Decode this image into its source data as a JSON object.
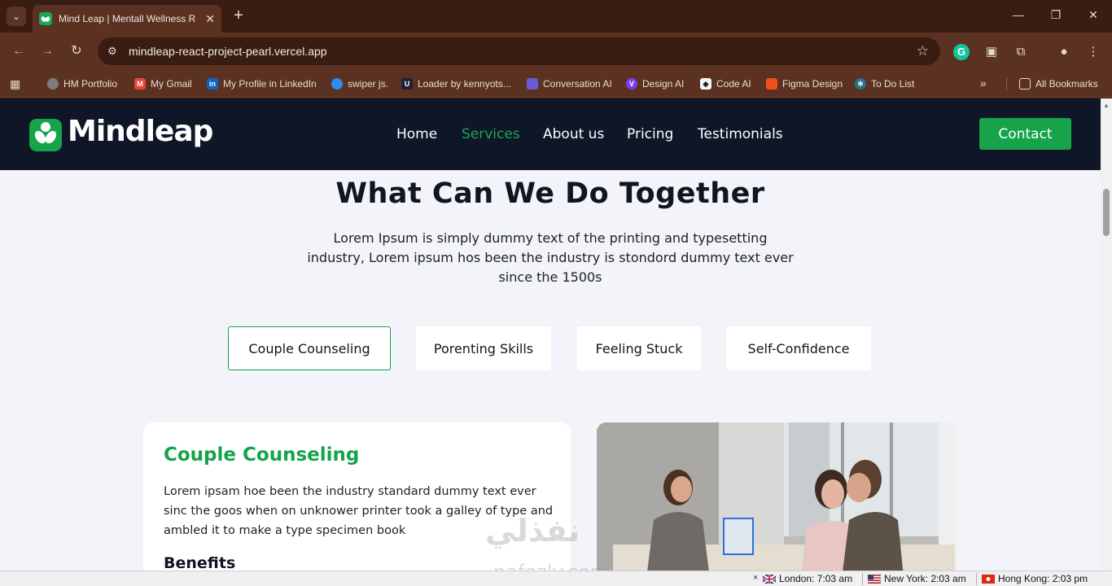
{
  "browser": {
    "tab_title": "Mind Leap | Mentall Wellness R",
    "url": "mindleap-react-project-pearl.vercel.app",
    "new_tab_icon": "plus-icon",
    "bookmarks": [
      {
        "label": "HM Portfolio",
        "icon": "globe-icon",
        "color": "#8a8a8a"
      },
      {
        "label": "My Gmail",
        "icon": "gmail-icon",
        "color": "#ea4335"
      },
      {
        "label": "My Profile in LinkedIn",
        "icon": "linkedin-icon",
        "color": "#0a66c2"
      },
      {
        "label": "swiper js.",
        "icon": "swiper-icon",
        "color": "#2b8cf2"
      },
      {
        "label": "Loader by kennyots...",
        "icon": "uiverse-icon",
        "color": "#1f1f3a"
      },
      {
        "label": "Conversation AI",
        "icon": "ai-icon",
        "color": "#6b5bd6"
      },
      {
        "label": "Design AI",
        "icon": "v0-icon",
        "color": "#7a3cf0"
      },
      {
        "label": "Code AI",
        "icon": "code-icon",
        "color": "#222222"
      },
      {
        "label": "Figma Design",
        "icon": "figma-icon",
        "color": "#f24e1e"
      },
      {
        "label": "To Do List",
        "icon": "react-icon",
        "color": "#2a6f8a"
      }
    ],
    "all_bookmarks": "All Bookmarks"
  },
  "site": {
    "logo": "Mindleap",
    "nav": [
      "Home",
      "Services",
      "About us",
      "Pricing",
      "Testimonials"
    ],
    "active_nav": "Services",
    "contact": "Contact",
    "brand_color": "#16a34a",
    "nav_bg": "#0e1628"
  },
  "section": {
    "title": "What Can We Do Together",
    "description": "Lorem Ipsum is simply dummy text of the printing and typesetting industry, Lorem ipsum hos been the industry is stondord dummy text ever since the 1500s",
    "tabs": [
      "Couple Counseling",
      "Porenting Skills",
      "Feeling Stuck",
      "Self-Confidence"
    ],
    "active_tab": "Couple Counseling"
  },
  "card": {
    "title": "Couple Counseling",
    "text": "Lorem ipsam hoe been the industry standard dummy text ever sinc the goos when on unknower printer took a galley of type and ambled it to make a type specimen book",
    "subtitle": "Benefits"
  },
  "status": {
    "clocks": [
      {
        "city": "London: 7:03 am",
        "flag": "uk-flag-icon"
      },
      {
        "city": "New York: 2:03 am",
        "flag": "us-flag-icon"
      },
      {
        "city": "Hong Kong: 2:03 pm",
        "flag": "hk-flag-icon"
      }
    ]
  },
  "watermark": {
    "arabic": "نفذلي",
    "latin": "nafezly.com"
  }
}
